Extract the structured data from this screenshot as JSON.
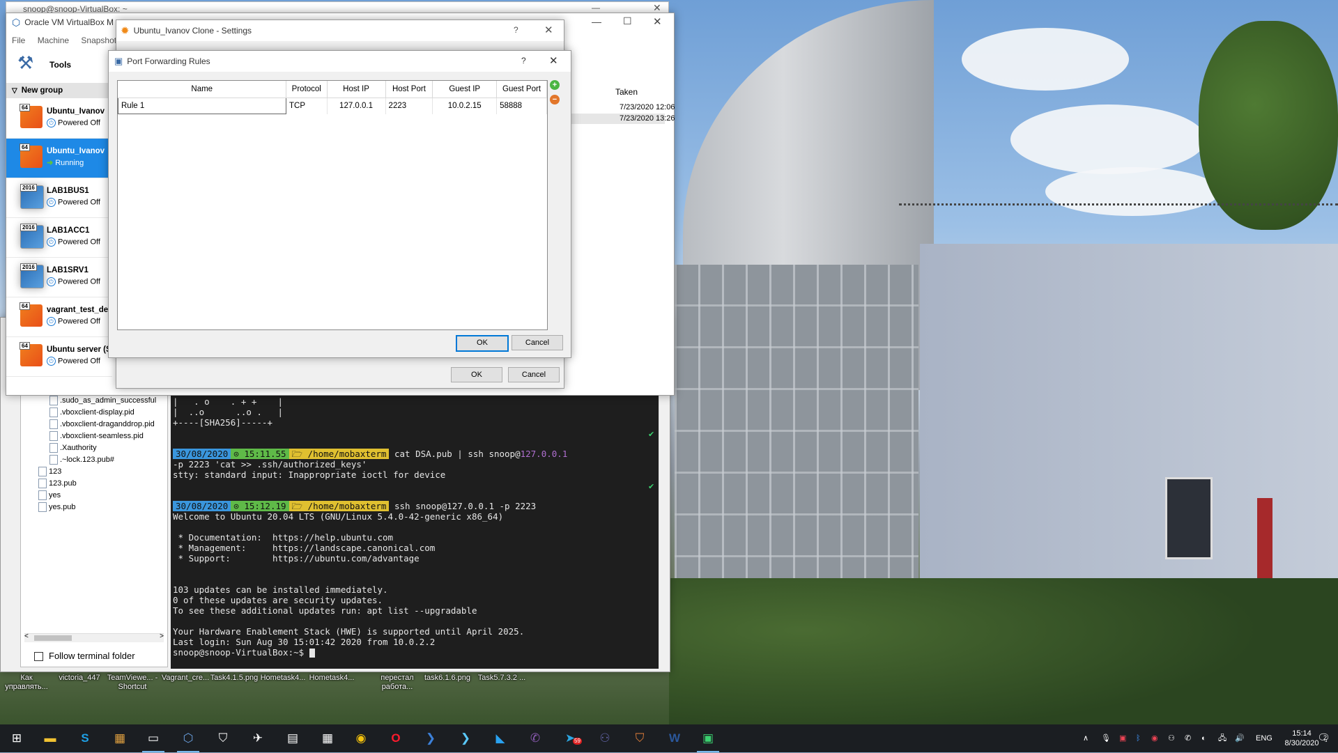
{
  "desktop": {
    "icons": [
      "Как управлять...",
      "victoria_447",
      "TeamViewe... - Shortcut",
      "Vagrant_cre...",
      "Task4.1.5.png",
      "Hometask4...",
      "Hometask4...",
      "перестал работа...",
      "task6.1.6.png",
      "Task5.7.3.2 ..."
    ]
  },
  "moba": {
    "files": [
      ".sudo_as_admin_successful",
      ".vboxclient-display.pid",
      ".vboxclient-draganddrop.pid",
      ".vboxclient-seamless.pid",
      ".Xauthority",
      ".~lock.123.pub#",
      "123",
      "123.pub",
      "yes",
      "yes.pub"
    ],
    "follow_label": "Follow terminal folder",
    "terminal": {
      "art1": "|   . o    . + +    |",
      "art2": "|  ..o      ..o .   |",
      "art3": "+----[SHA256]-----+",
      "p1_date": "30/08/2020",
      "p1_time": "⊙ 15:11.55",
      "p1_path": "🗁 /home/mobaxterm",
      "p1_cmd": "cat DSA.pub | ssh snoop@",
      "p1_ip": "127.0.0.1",
      "p1_cont": "-p 2223 'cat >> .ssh/authorized_keys'",
      "stty": "stty: standard input: Inappropriate ioctl for device",
      "p2_date": "30/08/2020",
      "p2_time": "⊙ 15:12.19",
      "p2_path": "🗁 /home/mobaxterm",
      "p2_cmd": "ssh snoop@127.0.0.1 -p 2223",
      "welcome": "Welcome to Ubuntu 20.04 LTS (GNU/Linux 5.4.0-42-generic x86_64)",
      "doc": " * Documentation:  https://help.ubuntu.com",
      "mgmt": " * Management:     https://landscape.canonical.com",
      "support": " * Support:        https://ubuntu.com/advantage",
      "upd1": "103 updates can be installed immediately.",
      "upd2": "0 of these updates are security updates.",
      "upd3": "To see these additional updates run: apt list --upgradable",
      "hwe": "Your Hardware Enablement Stack (HWE) is supported until April 2025.",
      "lastlogin": "Last login: Sun Aug 30 15:01:42 2020 from 10.0.2.2",
      "prompt": "snoop@snoop-VirtualBox:~$ "
    }
  },
  "vbox": {
    "behind_title": "snoop@snoop-VirtualBox: ~",
    "title": "Oracle VM VirtualBox M",
    "menu": [
      "File",
      "Machine",
      "Snapshot"
    ],
    "tools_label": "Tools",
    "group_label": "New group",
    "vms": [
      {
        "name": "Ubuntu_Ivanov",
        "state": "Powered Off",
        "badge": "64"
      },
      {
        "name": "Ubuntu_Ivanov",
        "state": "Running",
        "badge": "64"
      },
      {
        "name": "LAB1BUS1",
        "state": "Powered Off",
        "badge": "2016"
      },
      {
        "name": "LAB1ACC1",
        "state": "Powered Off",
        "badge": "2016"
      },
      {
        "name": "LAB1SRV1",
        "state": "Powered Off",
        "badge": "2016"
      },
      {
        "name": "vagrant_test_de",
        "state": "Powered Off",
        "badge": "64"
      },
      {
        "name": "Ubuntu server (Sn",
        "state": "Powered Off",
        "badge": "64"
      }
    ],
    "snapshots_header": "Taken",
    "snapshots": [
      "7/23/2020 12:06",
      "7/23/2020 13:26"
    ]
  },
  "settings": {
    "title": "Ubuntu_Ivanov Clone - Settings",
    "help": "?",
    "ok": "OK",
    "cancel": "Cancel"
  },
  "pfr": {
    "title": "Port Forwarding Rules",
    "help": "?",
    "columns": [
      "Name",
      "Protocol",
      "Host IP",
      "Host Port",
      "Guest IP",
      "Guest Port"
    ],
    "rule": {
      "name": "Rule 1",
      "protocol": "TCP",
      "host_ip": "127.0.0.1",
      "host_port": "2223",
      "guest_ip": "10.0.2.15",
      "guest_port": "58888"
    },
    "ok": "OK",
    "cancel": "Cancel"
  },
  "taskbar": {
    "lang": "ENG",
    "time": "15:14",
    "date": "8/30/2020",
    "notif_count": "2",
    "telegram_badge": "59"
  },
  "colors": {
    "accent": "#1e89e6",
    "terminal_bg": "#1e1e1e",
    "taskbar_bg": "#1b1e22"
  }
}
